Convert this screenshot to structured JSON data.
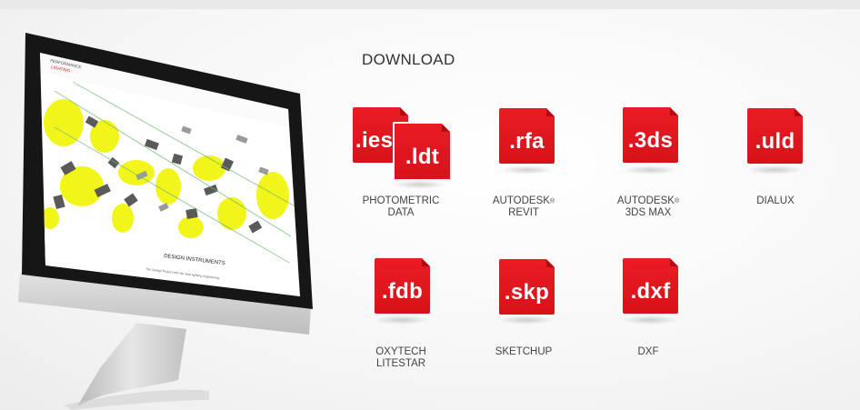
{
  "section": {
    "title": "DOWNLOAD"
  },
  "screen": {
    "brand_line1": "PERFORMANCE",
    "brand_line2": "LIGHTING",
    "hero_heading": "DESIGN INSTRUMENTS",
    "hero_sub": "The Design Project with the best lighting engineering"
  },
  "downloads": [
    {
      "ext": ".ies",
      "ext2": ".ldt",
      "line1": "PHOTOMETRIC",
      "line2": "DATA",
      "sup": ""
    },
    {
      "ext": ".rfa",
      "line1": "AUTODESK",
      "sup": "®",
      "line2": "REVIT"
    },
    {
      "ext": ".3ds",
      "line1": "AUTODESK",
      "sup": "®",
      "line2": "3DS MAX"
    },
    {
      "ext": ".uld",
      "line1": "DIALUX",
      "sup": "",
      "line2": ""
    },
    {
      "ext": ".fdb",
      "line1": "OXYTECH",
      "sup": "",
      "line2": "LITESTAR"
    },
    {
      "ext": ".skp",
      "line1": "SKETCHUP",
      "sup": "",
      "line2": ""
    },
    {
      "ext": ".dxf",
      "line1": "DXF",
      "sup": "",
      "line2": ""
    }
  ],
  "colors": {
    "accent": "#e3161d",
    "screen_highlight": "#f2f51a",
    "frame": "#1a1a1a"
  }
}
